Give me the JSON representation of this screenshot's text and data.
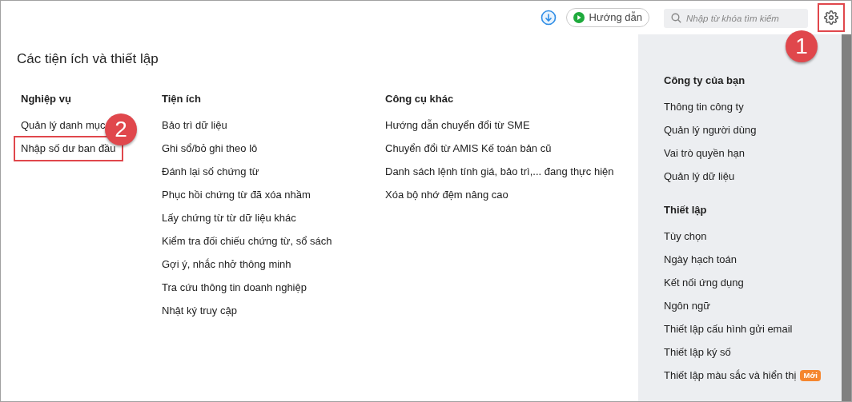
{
  "topbar": {
    "guide_button": "Hướng dẫn",
    "search": {
      "placeholder": "Nhập từ khóa tìm kiếm"
    },
    "settings": {
      "highlighted": true,
      "callout": "1"
    }
  },
  "title": "Các tiện ích và thiết lập",
  "columns": [
    {
      "heading": "Nghiệp vụ",
      "items": [
        {
          "label": "Quản lý danh mục",
          "highlighted": false
        },
        {
          "label": "Nhập số dư ban đầu",
          "highlighted": true,
          "callout": "2"
        }
      ]
    },
    {
      "heading": "Tiện ích",
      "items": [
        {
          "label": "Bảo trì dữ liệu",
          "highlighted": false
        },
        {
          "label": "Ghi sổ/bỏ ghi theo lô",
          "highlighted": false
        },
        {
          "label": "Đánh lại số chứng từ",
          "highlighted": false
        },
        {
          "label": "Phục hồi chứng từ đã xóa nhầm",
          "highlighted": false
        },
        {
          "label": "Lấy chứng từ từ dữ liệu khác",
          "highlighted": false
        },
        {
          "label": "Kiểm tra đối chiếu chứng từ, sổ sách",
          "highlighted": false
        },
        {
          "label": "Gợi ý, nhắc nhở thông minh",
          "highlighted": false
        },
        {
          "label": "Tra cứu thông tin doanh nghiệp",
          "highlighted": false
        },
        {
          "label": "Nhật ký truy cập",
          "highlighted": false
        }
      ]
    },
    {
      "heading": "Công cụ khác",
      "items": [
        {
          "label": "Hướng dẫn chuyển đổi từ SME",
          "highlighted": false
        },
        {
          "label": "Chuyển đổi từ AMIS Kế toán bản cũ",
          "highlighted": false
        },
        {
          "label": "Danh sách lệnh tính giá, bảo trì,... đang thực hiện",
          "highlighted": false
        },
        {
          "label": "Xóa bộ nhớ đệm nâng cao",
          "highlighted": false
        }
      ]
    }
  ],
  "side_panel": [
    {
      "heading": "Công ty của bạn",
      "items": [
        {
          "label": "Thông tin công ty"
        },
        {
          "label": "Quản lý người dùng"
        },
        {
          "label": "Vai trò quyền hạn"
        },
        {
          "label": "Quản lý dữ liệu"
        }
      ]
    },
    {
      "heading": "Thiết lập",
      "items": [
        {
          "label": "Tùy chọn"
        },
        {
          "label": "Ngày hạch toán"
        },
        {
          "label": "Kết nối ứng dụng"
        },
        {
          "label": "Ngôn ngữ"
        },
        {
          "label": "Thiết lập cấu hình gửi email"
        },
        {
          "label": "Thiết lập ký số"
        },
        {
          "label": "Thiết lập màu sắc và hiển thị",
          "badge": "Mới"
        }
      ]
    }
  ]
}
